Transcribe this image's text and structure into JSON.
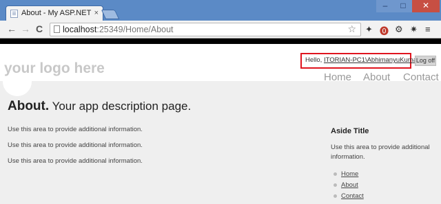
{
  "browser": {
    "tab_title": "About - My ASP.NET MVC",
    "tab_close": "×",
    "url_host": "localhost",
    "url_path": ":25349/Home/About",
    "controls": {
      "minimize": "–",
      "maximize": "□",
      "close": "✕"
    },
    "nav": {
      "back": "←",
      "forward": "→",
      "reload": "C"
    },
    "icons": {
      "star": "☆",
      "ext1": "✦",
      "ext2": "⓿",
      "ext3": "⚙",
      "ext4": "✷",
      "menu": "≡"
    }
  },
  "header": {
    "logo": "your logo here",
    "hello_prefix": "Hello, ",
    "username": "ITORIAN-PC1\\AbhimanyuKumar",
    "hello_suffix": "!",
    "logoff": "Log off",
    "menu": [
      "Home",
      "About",
      "Contact"
    ]
  },
  "main": {
    "title_strong": "About.",
    "title_light": " Your app description page.",
    "paragraphs": [
      "Use this area to provide additional information.",
      "Use this area to provide additional information.",
      "Use this area to provide additional information."
    ]
  },
  "aside": {
    "title": "Aside Title",
    "text": "Use this area to provide additional information.",
    "links": [
      "Home",
      "About",
      "Contact"
    ]
  }
}
